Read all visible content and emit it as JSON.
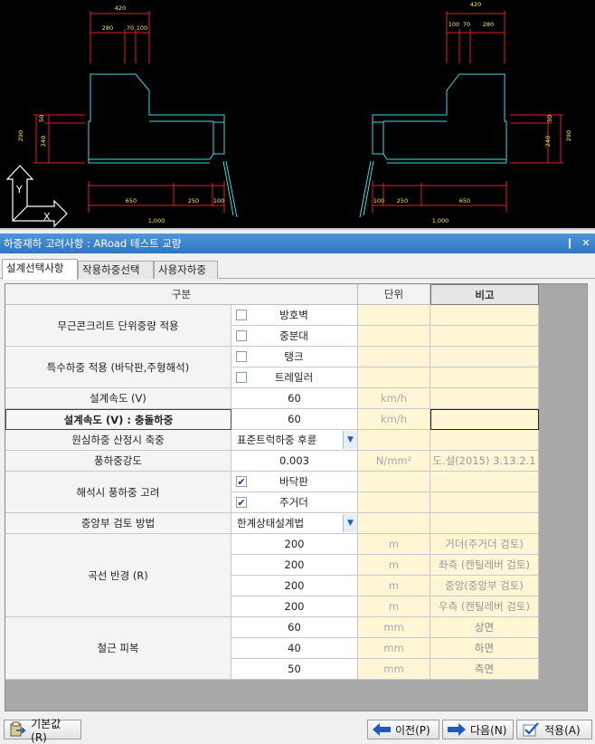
{
  "cad": {
    "left_dims": {
      "top_total": "420",
      "top_a": "280",
      "top_b": "70",
      "top_c": "100",
      "side_a": "50",
      "side_b": "240",
      "side_total": "290",
      "bot_a": "650",
      "bot_b": "250",
      "bot_c": "100",
      "bot_total": "1,000"
    },
    "right_dims": {
      "top_total": "420",
      "top_a": "100",
      "top_b": "70",
      "top_c": "280",
      "side_a": "50",
      "side_b": "240",
      "side_total": "290",
      "bot_a": "100",
      "bot_b": "250",
      "bot_c": "650",
      "bot_total": "1,000"
    },
    "axis_y": "Y",
    "axis_x": "X",
    "line_color": "#3fd9e6",
    "dim_color": "#e02020"
  },
  "panel": {
    "title": "하중재하 고려사항 : ARoad 테스트 교량",
    "pin_icon": "pin-icon",
    "close_icon": "close-icon"
  },
  "tabs": [
    {
      "label": "설계선택사항"
    },
    {
      "label": "작용하중선택"
    },
    {
      "label": "사용자하중"
    }
  ],
  "grid": {
    "headers": {
      "category": "구분",
      "unit": "단위",
      "note": "비고"
    },
    "rows": {
      "concrete_label": "무근콘크리트 단위중량 적용",
      "concrete_guard": "방호벽",
      "concrete_median": "중분대",
      "special_label": "특수하중 적용 (바닥판,주형해석)",
      "special_tank": "탱크",
      "special_trailer": "트레일러",
      "speed_label": "설계속도 (V)",
      "speed_value": "60",
      "speed_unit": "km/h",
      "collision_label": "설계속도 (V) : 충돌하중",
      "collision_value": "60",
      "collision_unit": "km/h",
      "centrifugal_label": "원심하중 산정시 축중",
      "centrifugal_value": "표준트럭하중 후륜",
      "wind_label": "풍하중강도",
      "wind_value": "0.003",
      "wind_unit": "N/mm²",
      "wind_note": "도.설(2015) 3.13.2.1",
      "wind_consider_label": "해석시 풍하중 고려",
      "wind_deck": "바닥판",
      "wind_girder": "주거더",
      "central_label": "중앙부 검토 방법",
      "central_value": "한계상태설계법",
      "radius_label": "곡선 반경 (R)",
      "radius_values": [
        "200",
        "200",
        "200",
        "200"
      ],
      "radius_unit": "m",
      "radius_notes": [
        "거더(주거더 검토)",
        "좌측 (캔틸레버 검토)",
        "중앙(중앙부 검토)",
        "우측 (캔틸레버 검토)"
      ],
      "cover_label": "철근 피복",
      "cover_values": [
        "60",
        "40",
        "50"
      ],
      "cover_unit": "mm",
      "cover_notes": [
        "상면",
        "하면",
        "측면"
      ]
    },
    "checks": {
      "guard": false,
      "median": false,
      "tank": false,
      "trailer": false,
      "deck": true,
      "girder": true
    }
  },
  "buttons": {
    "default": "기본값(R)",
    "prev": "이전(P)",
    "next": "다음(N)",
    "apply": "적용(A)"
  }
}
